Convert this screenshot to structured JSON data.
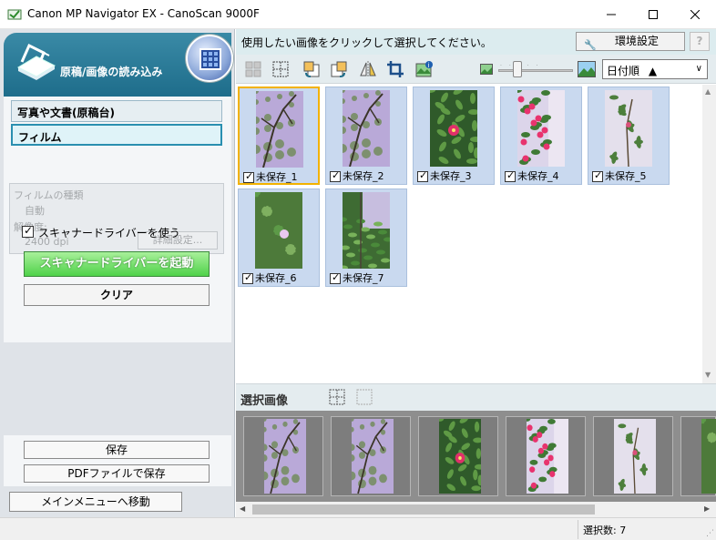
{
  "window": {
    "title": "Canon MP Navigator EX - CanoScan 9000F"
  },
  "left_panel": {
    "mode_title": "原稿/画像の読み込み",
    "source_options": [
      {
        "label": "写真や文書(原稿台)",
        "active": false
      },
      {
        "label": "フィルム",
        "active": true
      }
    ],
    "film_settings": {
      "film_type_label": "フィルムの種類",
      "film_type_value": "自動",
      "resolution_label": "解像度:",
      "resolution_value": "2400 dpi",
      "detail_button": "詳細設定..."
    },
    "use_driver_label": "スキャナードライバーを使う",
    "use_driver_checked": true,
    "start_driver_button": "スキャナードライバーを起動",
    "clear_button": "クリア",
    "save_button": "保存",
    "save_pdf_button": "PDFファイルで保存",
    "main_menu_button": "メインメニューへ移動"
  },
  "right_panel": {
    "hint": "使用したい画像をクリックして選択してください。",
    "preferences_button": "環境設定",
    "help_button": "?",
    "sort_value": "日付順",
    "thumbnails": [
      {
        "label": "未保存_1",
        "checked": true,
        "selected": true,
        "scene": "wall"
      },
      {
        "label": "未保存_2",
        "checked": true,
        "selected": false,
        "scene": "wall"
      },
      {
        "label": "未保存_3",
        "checked": true,
        "selected": false,
        "scene": "camellia"
      },
      {
        "label": "未保存_4",
        "checked": true,
        "selected": false,
        "scene": "flowers"
      },
      {
        "label": "未保存_5",
        "checked": true,
        "selected": false,
        "scene": "branch"
      },
      {
        "label": "未保存_6",
        "checked": true,
        "selected": false,
        "scene": "leaves"
      },
      {
        "label": "未保存_7",
        "checked": true,
        "selected": false,
        "scene": "garden"
      }
    ],
    "selected_section_title": "選択画像"
  },
  "status": {
    "selected_count": "選択数: 7"
  },
  "colors": {
    "accent_teal": "#1d6c8a",
    "start_green": "#4fd24a",
    "selection_border": "#f2b200",
    "thumb_bg": "#c9d9ef"
  }
}
